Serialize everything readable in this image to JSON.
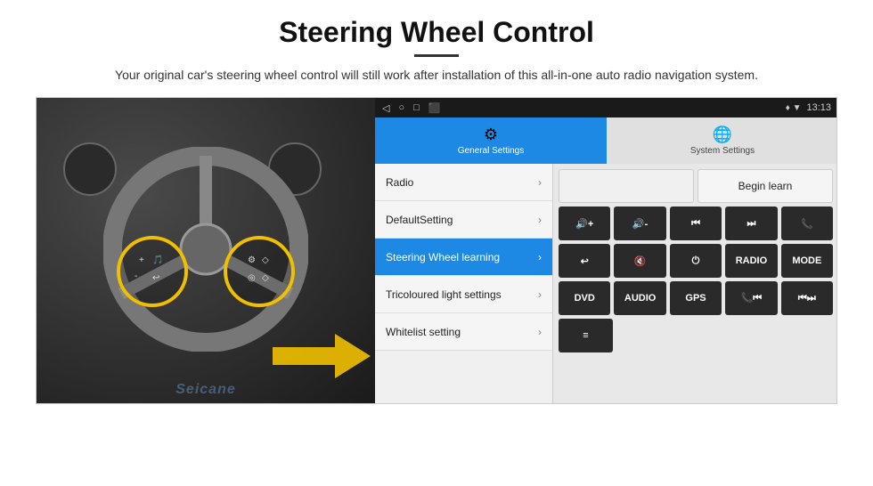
{
  "header": {
    "title": "Steering Wheel Control",
    "subtitle": "Your original car's steering wheel control will still work after installation of this all-in-one auto radio navigation system."
  },
  "statusBar": {
    "icons": [
      "◁",
      "○",
      "□",
      "⬛"
    ],
    "right": "♦ ▼ 13:13"
  },
  "tabs": [
    {
      "label": "General Settings",
      "active": true
    },
    {
      "label": "System Settings",
      "active": false
    }
  ],
  "menuItems": [
    {
      "label": "Radio",
      "active": false
    },
    {
      "label": "DefaultSetting",
      "active": false
    },
    {
      "label": "Steering Wheel learning",
      "active": true
    },
    {
      "label": "Tricoloured light settings",
      "active": false
    },
    {
      "label": "Whitelist setting",
      "active": false
    }
  ],
  "controls": {
    "beginLearn": "Begin learn",
    "buttons": {
      "row1": [
        "🔇+",
        "🔇-",
        "⏮",
        "⏭",
        "📞"
      ],
      "row2": [
        "↩",
        "🔇x",
        "⏻",
        "RADIO",
        "MODE"
      ],
      "row3": [
        "DVD",
        "AUDIO",
        "GPS",
        "🔊⏮",
        "⏮⏭"
      ],
      "row4": [
        "≡"
      ]
    }
  },
  "watermark": "Seicane"
}
